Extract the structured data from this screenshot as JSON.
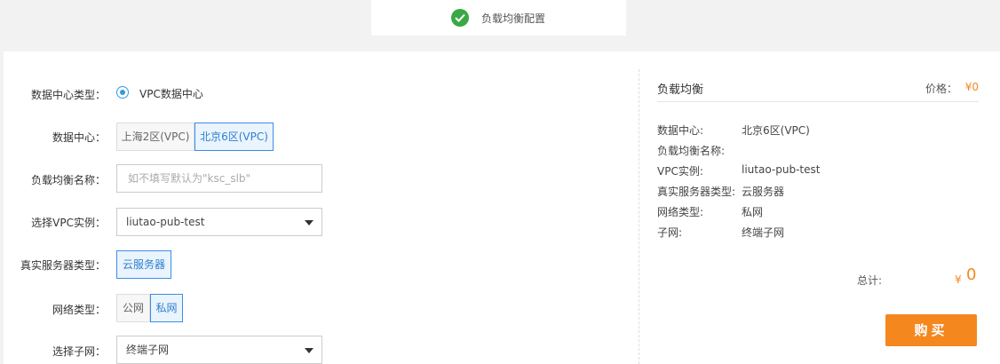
{
  "step": {
    "label": "负载均衡配置",
    "icon": "check-circle-icon",
    "icon_color": "#3aa845"
  },
  "form": {
    "dc_type": {
      "label": "数据中心类型：",
      "option": "VPC数据中心"
    },
    "datacenter": {
      "label": "数据中心：",
      "options": [
        "上海2区(VPC)",
        "北京6区(VPC)"
      ],
      "selected": "北京6区(VPC)"
    },
    "lb_name": {
      "label": "负载均衡名称：",
      "placeholder": "如不填写默认为\"ksc_slb\""
    },
    "vpc_instance": {
      "label": "选择VPC实例：",
      "value": "liutao-pub-test"
    },
    "server_type": {
      "label": "真实服务器类型：",
      "options": [
        "云服务器"
      ],
      "selected": "云服务器"
    },
    "network_type": {
      "label": "网络类型：",
      "options": [
        "公网",
        "私网"
      ],
      "selected": "私网"
    },
    "subnet": {
      "label": "选择子网：",
      "value": "终端子网"
    }
  },
  "summary": {
    "title": "负载均衡",
    "price_label": "价格：",
    "price_value": "¥0",
    "rows": [
      {
        "key": "数据中心:",
        "value": "北京6区(VPC)"
      },
      {
        "key": "负载均衡名称:",
        "value": ""
      },
      {
        "key": "VPC实例:",
        "value": "liutao-pub-test"
      },
      {
        "key": "真实服务器类型:",
        "value": "云服务器"
      },
      {
        "key": "网络类型:",
        "value": "私网"
      },
      {
        "key": "子网:",
        "value": "终端子网"
      }
    ],
    "total_label": "总计:",
    "total_currency": "¥",
    "total_value": "0",
    "buy_label": "购买"
  },
  "colors": {
    "accent": "#3a8ee6",
    "price": "#f5871f",
    "success": "#3aa845"
  }
}
